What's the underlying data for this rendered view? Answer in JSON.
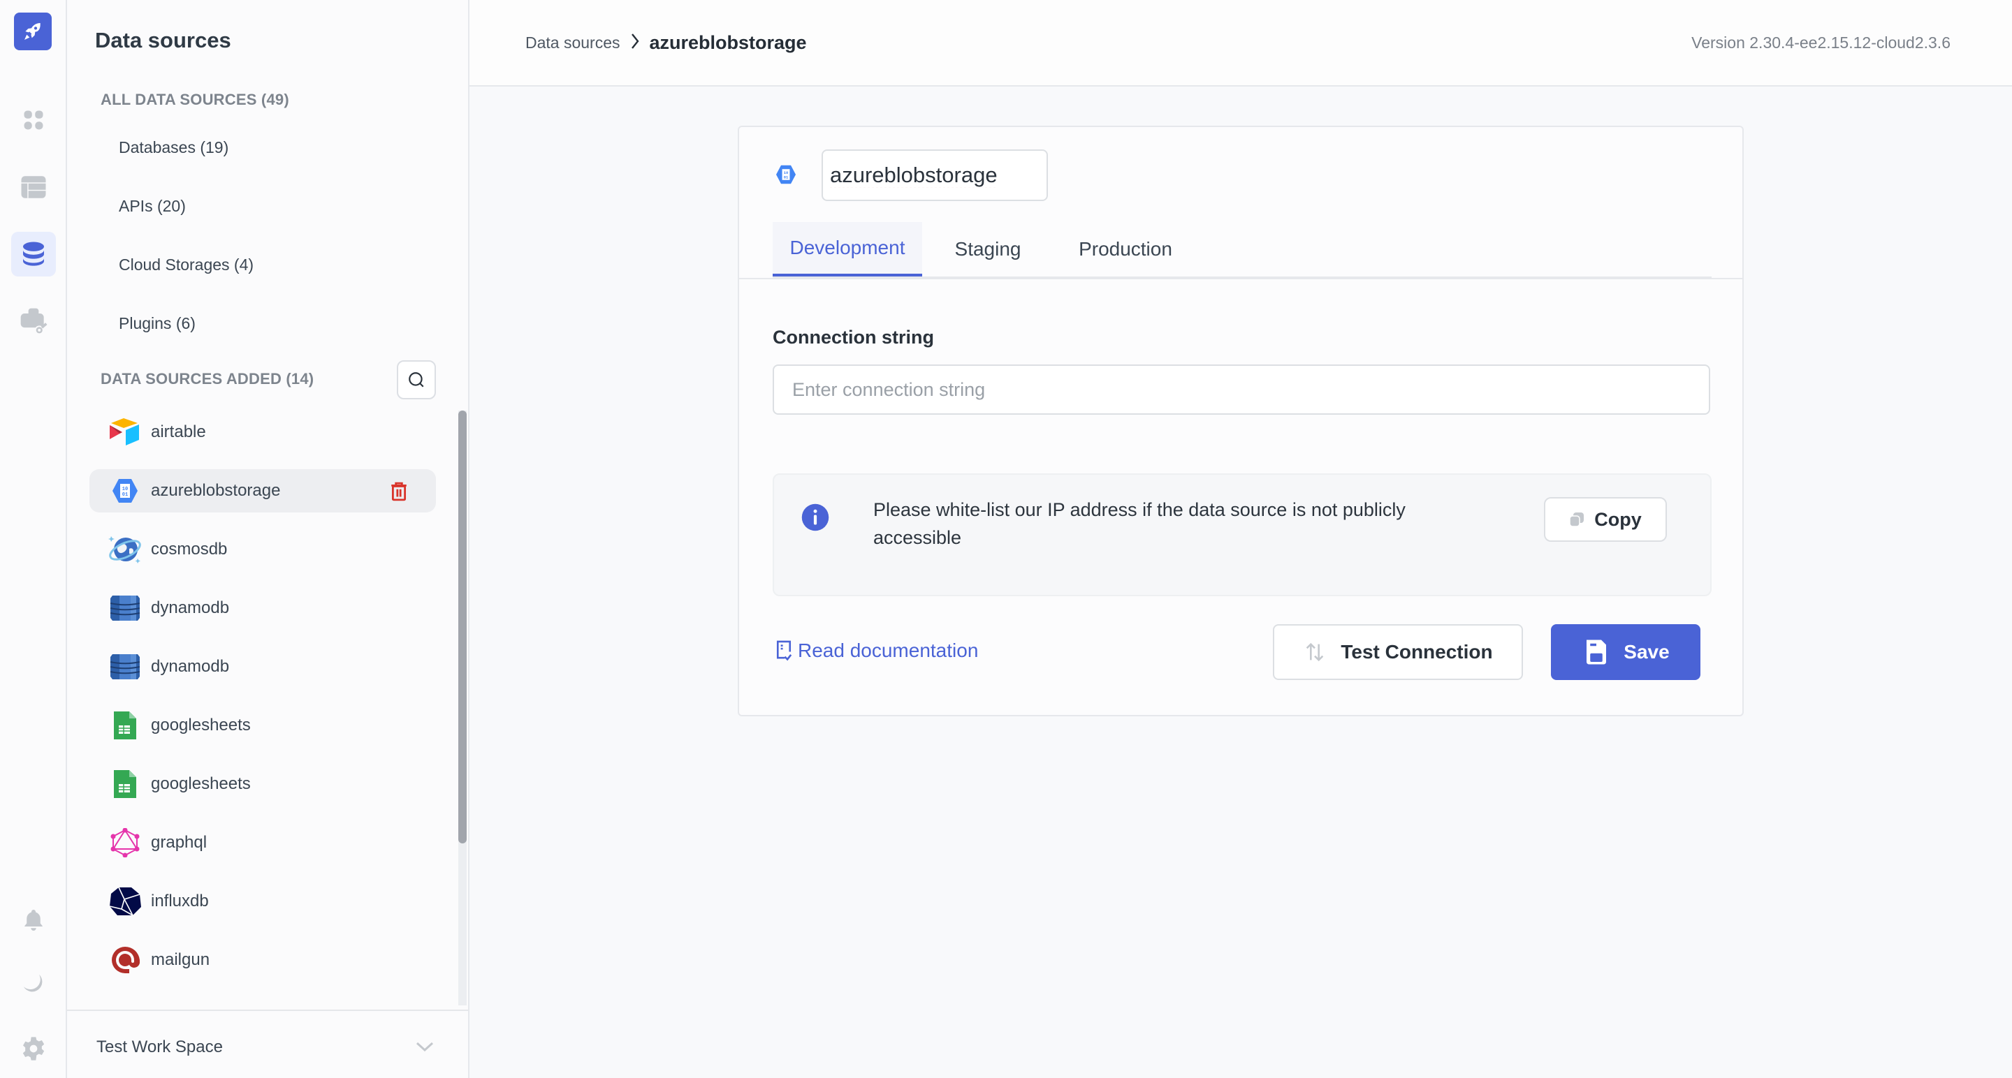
{
  "rail": {
    "items": [
      {
        "name": "apps",
        "icon": "grid-icon"
      },
      {
        "name": "tables",
        "icon": "table-icon"
      },
      {
        "name": "data-sources",
        "icon": "database-icon",
        "active": true
      },
      {
        "name": "workspace-variables",
        "icon": "briefcase-key-icon"
      }
    ],
    "bottom": [
      {
        "name": "notifications",
        "icon": "bell-icon"
      },
      {
        "name": "theme",
        "icon": "moon-icon"
      },
      {
        "name": "settings",
        "icon": "gear-icon"
      }
    ]
  },
  "sidebar": {
    "title": "Data sources",
    "all_label": "ALL DATA SOURCES (49)",
    "categories": [
      {
        "label": "Databases (19)"
      },
      {
        "label": "APIs (20)"
      },
      {
        "label": "Cloud Storages (4)"
      },
      {
        "label": "Plugins (6)"
      }
    ],
    "added_label": "DATA SOURCES ADDED (14)",
    "added": [
      {
        "label": "airtable",
        "icon": "airtable-icon"
      },
      {
        "label": "azureblobstorage",
        "icon": "azure-blob-icon",
        "selected": true
      },
      {
        "label": "cosmosdb",
        "icon": "cosmosdb-icon"
      },
      {
        "label": "dynamodb",
        "icon": "dynamodb-icon"
      },
      {
        "label": "dynamodb",
        "icon": "dynamodb-icon"
      },
      {
        "label": "googlesheets",
        "icon": "googlesheets-icon"
      },
      {
        "label": "googlesheets",
        "icon": "googlesheets-icon"
      },
      {
        "label": "graphql",
        "icon": "graphql-icon"
      },
      {
        "label": "influxdb",
        "icon": "influxdb-icon"
      },
      {
        "label": "mailgun",
        "icon": "mailgun-icon"
      }
    ],
    "workspace": "Test Work Space"
  },
  "header": {
    "breadcrumb_root": "Data sources",
    "breadcrumb_current": "azureblobstorage",
    "version": "Version 2.30.4-ee2.15.12-cloud2.3.6"
  },
  "main": {
    "name_value": "azureblobstorage",
    "tabs": [
      {
        "label": "Development",
        "active": true
      },
      {
        "label": "Staging"
      },
      {
        "label": "Production"
      }
    ],
    "connection_label": "Connection string",
    "connection_placeholder": "Enter connection string",
    "connection_value": "",
    "info_text": "Please white-list our IP address if the data source is not publicly accessible",
    "copy_label": "Copy",
    "read_doc_label": "Read documentation",
    "test_label": "Test Connection",
    "save_label": "Save"
  },
  "colors": {
    "accent": "#4a63d6",
    "danger": "#d9342b",
    "selected_bg": "#edeef1"
  }
}
